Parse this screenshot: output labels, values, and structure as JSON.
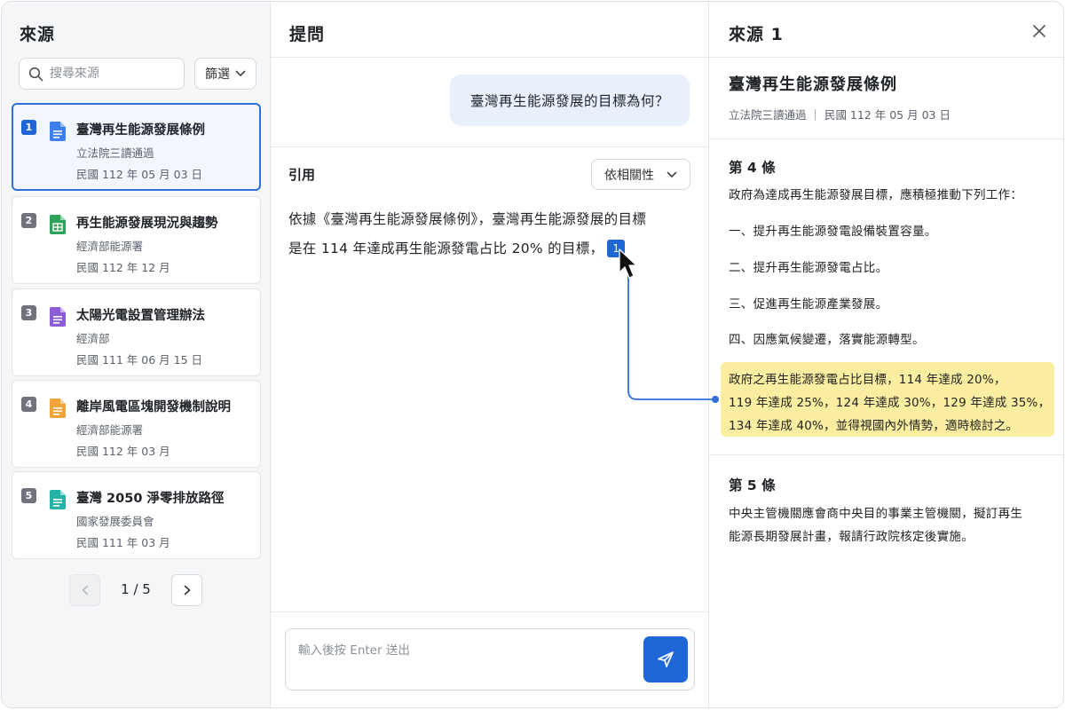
{
  "sources_panel": {
    "title": "來源",
    "search_placeholder": "搜尋來源",
    "filter_label": "篩選",
    "items": [
      {
        "num": "1",
        "title": "臺灣再生能源發展條例",
        "subtitle": "立法院三讀通過",
        "date": "民國 112 年 05 月 03 日",
        "icon": "blue-doc-icon",
        "color": "#3d7ef0"
      },
      {
        "num": "2",
        "title": "再生能源發展現況與趨勢",
        "subtitle": "經濟部能源署",
        "date": "民國 112 年 12 月",
        "icon": "green-sheet-icon",
        "color": "#2fa15a"
      },
      {
        "num": "3",
        "title": "太陽光電設置管理辦法",
        "subtitle": "經濟部",
        "date": "民國 111 年 06 月 15 日",
        "icon": "purple-doc-icon",
        "color": "#8c5bd6"
      },
      {
        "num": "4",
        "title": "離岸風電區塊開發機制說明",
        "subtitle": "經濟部能源署",
        "date": "民國 112 年 03 月",
        "icon": "orange-doc-icon",
        "color": "#f0a43a"
      },
      {
        "num": "5",
        "title": "臺灣 2050 淨零排放路徑",
        "subtitle": "國家發展委員會",
        "date": "民國 111 年 03 月",
        "icon": "teal-doc-icon",
        "color": "#23b3a8"
      }
    ],
    "pagination": "1 / 5"
  },
  "question_panel": {
    "title": "提問",
    "question": "臺灣再生能源發展的目標為何？",
    "citation_label": "引用",
    "sort_label": "依相關性",
    "answer_line1": "依據《臺灣再生能源發展條例》，臺灣再生能源發展的目標",
    "answer_line2": "是在 114 年達成再生能源發電占比 20% 的目標，",
    "citation_ref": "1",
    "input_placeholder": "輸入後按 Enter 送出"
  },
  "source_detail": {
    "title": "來源 1",
    "doc_title": "臺灣再生能源發展條例",
    "doc_meta": "立法院三讀通過 ｜ 民國 112 年 05 月 03 日",
    "article4": {
      "heading": "第 4 條",
      "intro": "政府為達成再生能源發展目標，應積極推動下列工作：",
      "items": [
        "一、提升再生能源發電設備裝置容量。",
        "二、提升再生能源發電占比。",
        "三、促進再生能源產業發展。",
        "四、因應氣候變遷，落實能源轉型。"
      ],
      "highlight": [
        "政府之再生能源發電占比目標，114 年達成 20%，",
        "119 年達成 25%，124 年達成 30%，129 年達成 35%，",
        "134 年達成 40%，並得視國內外情勢，適時檢討之。"
      ]
    },
    "article5": {
      "heading": "第 5 條",
      "lines": [
        "中央主管機關應會商中央目的事業主管機關，擬訂再生",
        "能源長期發展計畫，報請行政院核定後實施。"
      ]
    }
  },
  "colors": {
    "accent": "#1f66d6",
    "highlight": "#fbeea0"
  }
}
